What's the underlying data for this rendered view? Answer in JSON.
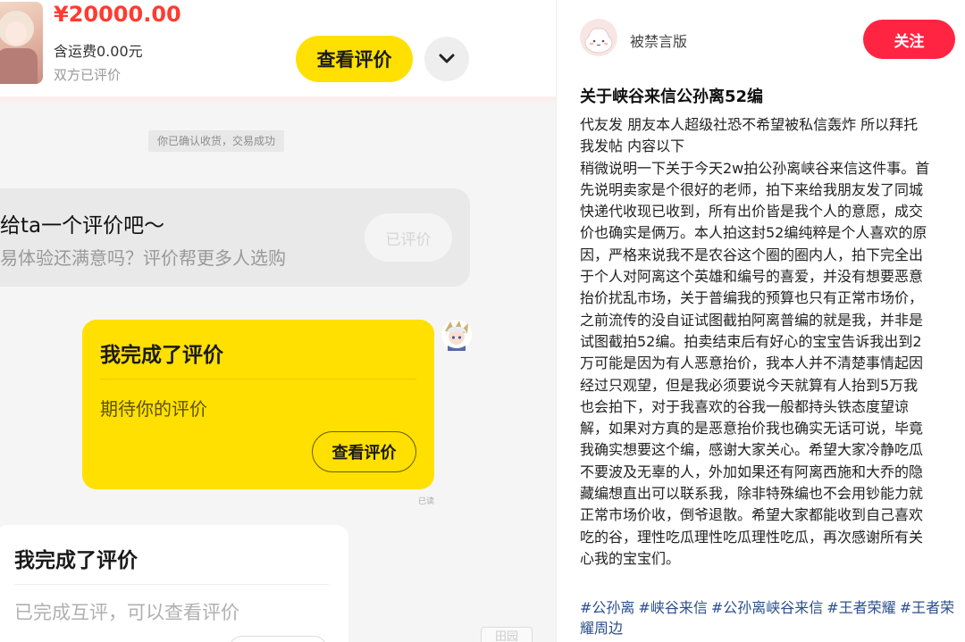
{
  "order": {
    "price": "¥20000.00",
    "shipping": "含运费0.00元",
    "status": "双方已评价",
    "view_review_label": "查看评价"
  },
  "chat": {
    "system_message": "你已确认收货，交易成功",
    "invite": {
      "title": "给ta一个评价吧～",
      "subtitle": "易体验还满意吗？评价帮更多人选购",
      "button_label": "已评价"
    },
    "my_review_card": {
      "title": "我完成了评价",
      "subtitle": "期待你的评价",
      "button_label": "查看评价",
      "read_status": "已读"
    },
    "their_review_card": {
      "title": "我完成了评价",
      "subtitle": "已完成互评，可以查看评价"
    },
    "corner_stub_label": "田园"
  },
  "post": {
    "author": "被禁言版",
    "follow_label": "关注",
    "title": "关于峡谷来信公孙离52编",
    "body_lines": [
      "代友发 朋友本人超级社恐不希望被私信轰炸 所以拜托",
      "我发帖 内容以下",
      "稍微说明一下关于今天2w拍公孙离峡谷来信这件事。首",
      "先说明卖家是个很好的老师，拍下来给我朋友发了同城",
      "快递代收现已收到，所有出价皆是我个人的意愿，成交",
      "价也确实是俩万。本人拍这封52编纯粹是个人喜欢的原",
      "因，严格来说我不是农谷这个圈的圈内人，拍下完全出",
      "于个人对阿离这个英雄和编号的喜爱，并没有想要恶意",
      "抬价扰乱市场，关于普编我的预算也只有正常市场价，",
      "之前流传的没自证试图截拍阿离普编的就是我，并非是",
      "试图截拍52编。拍卖结束后有好心的宝宝告诉我出到2",
      "万可能是因为有人恶意抬价，我本人并不清楚事情起因",
      "经过只观望，但是我必须要说今天就算有人抬到5万我",
      "也会拍下，对于我喜欢的谷我一般都持头铁态度望谅",
      "解，如果对方真的是恶意抬价我也确实无话可说，毕竟",
      "我确实想要这个编，感谢大家关心。希望大家冷静吃瓜",
      "不要波及无辜的人，外加如果还有阿离西施和大乔的隐",
      "藏编想直出可以联系我，除非特殊编也不会用钞能力就",
      "正常市场价收，倒爷退散。希望大家都能收到自己喜欢",
      "吃的谷，理性吃瓜理性吃瓜理性吃瓜，再次感谢所有关",
      "心我的宝宝们。"
    ],
    "tags": [
      "#公孙离",
      "#峡谷来信",
      "#公孙离峡谷来信",
      "#王者荣耀",
      "#王者荣耀周边"
    ]
  },
  "colors": {
    "price_red": "#ff3b30",
    "accent_yellow": "#ffe000",
    "follow_red": "#ff2442",
    "tag_blue": "#2b4f8c"
  }
}
